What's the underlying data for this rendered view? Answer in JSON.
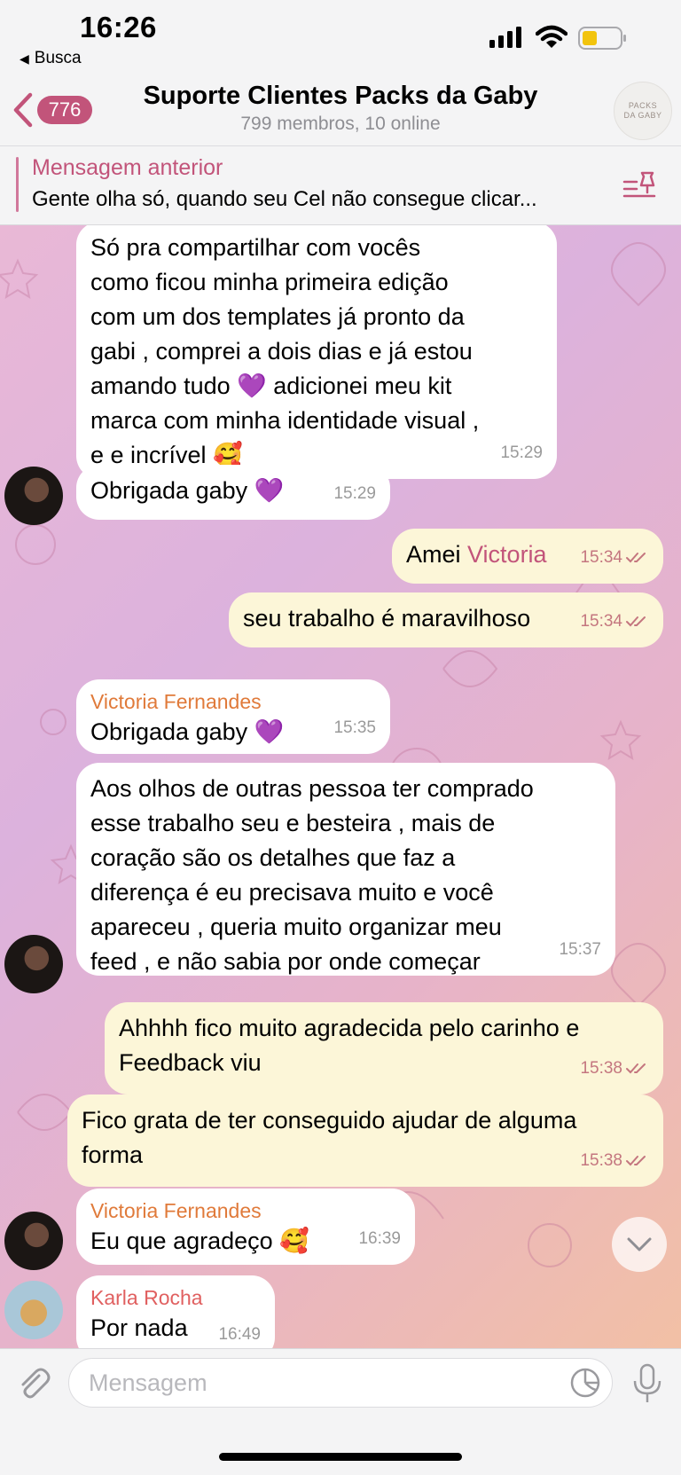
{
  "status_bar": {
    "time": "16:26",
    "back_app": "Busca"
  },
  "header": {
    "badge": "776",
    "title": "Suporte Clientes Packs da Gaby",
    "subtitle": "799 membros, 10 online",
    "avatar_text_1": "PACKS",
    "avatar_text_2": "DA GABY"
  },
  "pinned": {
    "title": "Mensagem anterior",
    "text": "Gente olha só, quando seu Cel não consegue clicar..."
  },
  "messages": [
    {
      "type": "in",
      "lines": [
        "Só pra compartilhar com vocês",
        "como ficou minha primeira edição",
        "com um dos templates já pronto da",
        "gabi , comprei a dois dias e já estou",
        "amando tudo 💜 adicionei meu kit",
        "marca com minha identidade visual ,",
        "e e incrível 🥰"
      ],
      "time": "15:29"
    },
    {
      "type": "in",
      "text": "Obrigada gaby 💜",
      "time": "15:29"
    },
    {
      "type": "out",
      "text": "Amei ",
      "mention": "Victoria",
      "time": "15:34"
    },
    {
      "type": "out",
      "text": "seu trabalho é maravilhoso",
      "time": "15:34"
    },
    {
      "type": "in",
      "sender": "Victoria Fernandes",
      "text": "Obrigada gaby 💜",
      "time": "15:35"
    },
    {
      "type": "in",
      "lines": [
        "Aos olhos de outras pessoa ter comprado",
        "esse trabalho seu e besteira , mais de",
        "coração são os detalhes que faz a",
        "diferença é eu precisava muito e você",
        "apareceu , queria muito organizar meu",
        "feed , e não sabia por onde começar"
      ],
      "time": "15:37"
    },
    {
      "type": "out",
      "lines": [
        "Ahhhh fico muito agradecida pelo carinho e",
        "Feedback viu"
      ],
      "time": "15:38"
    },
    {
      "type": "out",
      "lines": [
        "Fico grata de ter conseguido ajudar de alguma",
        "forma"
      ],
      "time": "15:38"
    },
    {
      "type": "in",
      "sender": "Victoria Fernandes",
      "text": "Eu que agradeço 🥰",
      "time": "16:39"
    },
    {
      "type": "in",
      "sender": "Karla Rocha",
      "text": "Por nada",
      "time": "16:49"
    }
  ],
  "input": {
    "placeholder": "Mensagem"
  },
  "colors": {
    "accent": "#c2547a",
    "outgoing_bubble": "#fcf6d8",
    "incoming_bubble": "#ffffff",
    "sender_victoria": "#e07a3a",
    "sender_karla": "#e06060"
  }
}
